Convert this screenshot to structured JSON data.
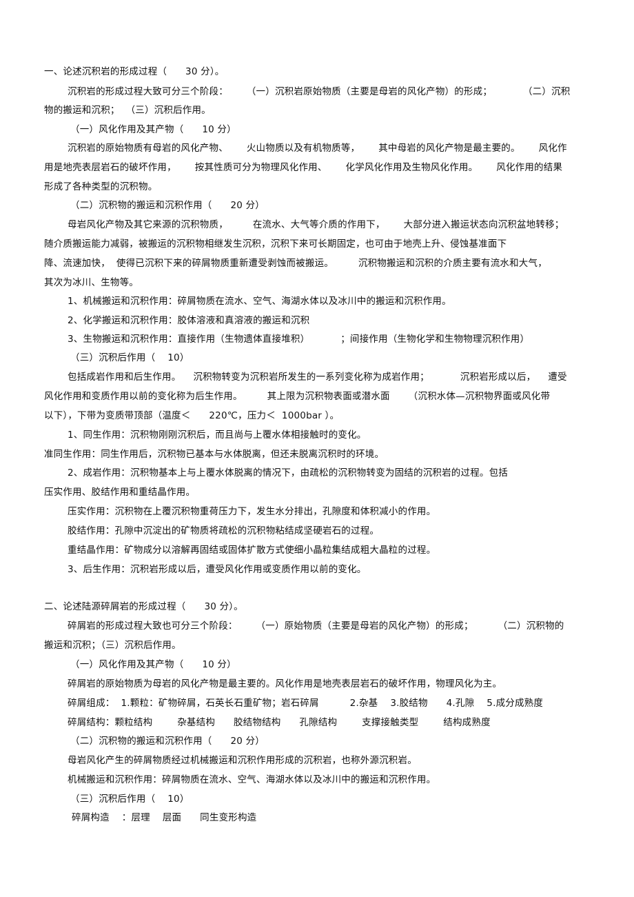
{
  "document": {
    "lines": [
      {
        "id": "q1-title",
        "text": "一、论述沉积岩的形成过程（      30 分）。"
      },
      {
        "id": "q1-intro-1",
        "text": "沉积岩的形成过程大致可分三个阶段：      （一）沉积岩原始物质（主要是母岩的风化产物）的形成；          （二）沉积"
      },
      {
        "id": "q1-intro-2",
        "text": "物的搬运和沉积；  （三）沉积后作用。"
      },
      {
        "id": "q1-s1-heading",
        "text": "（一）风化作用及其产物（      10 分）"
      },
      {
        "id": "q1-s1-p1",
        "text": "沉积岩的原始物质有母岩的风化产物、      火山物质以及有机物质等，      其中母岩的风化产物是最主要的。      风化作"
      },
      {
        "id": "q1-s1-p2",
        "text": "用是地壳表层岩石的破坏作用，      按其性质可分为物理风化作用、      化学风化作用及生物风化作用。      风化作用的结果"
      },
      {
        "id": "q1-s1-p3",
        "text": "形成了各种类型的沉积物。"
      },
      {
        "id": "q1-s2-heading",
        "text": "（二）沉积物的搬运和沉积作用（      20 分）"
      },
      {
        "id": "q1-s2-p1",
        "text": "母岩风化产物及其它来源的沉积物质，        在流水、大气等介质的作用下，      大部分进入搬运状态向沉积盆地转移；"
      },
      {
        "id": "q1-s2-p2",
        "text": "随介质搬运能力减弱，被搬运的沉积物相继发生沉积，沉积下来可长期固定，也可由于地壳上升、侵蚀基准面下"
      },
      {
        "id": "q1-s2-p3",
        "text": "降、流速加快，  使得已沉积下来的碎屑物质重新遭受剥蚀而被搬运。        沉积物搬运和沉积的介质主要有流水和大气，"
      },
      {
        "id": "q1-s2-p4",
        "text": "其次为冰川、生物等。"
      },
      {
        "id": "q1-s2-i1",
        "text": "1、机械搬运和沉积作用：碎屑物质在流水、空气、海湖水体以及冰川中的搬运和沉积作用。"
      },
      {
        "id": "q1-s2-i2",
        "text": "2、化学搬运和沉积作用：胶体溶液和真溶液的搬运和沉积"
      },
      {
        "id": "q1-s2-i3",
        "text": "3、生物搬运和沉积作用：直接作用（生物遗体直接堆积）          ；间接作用（生物化学和生物物理沉积作用）"
      },
      {
        "id": "q1-s3-heading",
        "text": "（三）沉积后作用（    10）"
      },
      {
        "id": "q1-s3-p1",
        "text": "包括成岩作用和后生作用。    沉积物转变为沉积岩所发生的一系列变化称为成岩作用；          沉积岩形成以后，    遭受"
      },
      {
        "id": "q1-s3-p2",
        "text": "风化作用和变质作用以前的变化称为后生作用。        其上限为沉积物表面或潜水面      （沉积水体—沉积物界面或风化带"
      },
      {
        "id": "q1-s3-p3",
        "text": "以下），下带为变质带顶部（温度＜      220℃，压力＜  1000bar ）。"
      },
      {
        "id": "q1-s3-i1",
        "text": "1、同生作用：沉积物刚刚沉积后，而且尚与上覆水体相接触时的变化。"
      },
      {
        "id": "q1-s3-i1b",
        "text": "准同生作用：同生作用后，沉积物已基本与水体脱离，但还未脱离沉积时的环境。"
      },
      {
        "id": "q1-s3-i2",
        "text": "2、成岩作用：沉积物基本上与上覆水体脱离的情况下，由疏松的沉积物转变为固结的沉积岩的过程。包括"
      },
      {
        "id": "q1-s3-i2b",
        "text": "压实作用、胶结作用和重结晶作用。"
      },
      {
        "id": "q1-s3-i2c",
        "text": "压实作用：沉积物在上覆沉积物重荷压力下，发生水分排出，孔隙度和体积减小的作用。"
      },
      {
        "id": "q1-s3-i2d",
        "text": "胶结作用：孔隙中沉淀出的矿物质将疏松的沉积物粘结成坚硬岩石的过程。"
      },
      {
        "id": "q1-s3-i2e",
        "text": "重结晶作用：矿物成分以溶解再固结或固体扩散方式使细小晶粒集结成粗大晶粒的过程。"
      },
      {
        "id": "q1-s3-i3",
        "text": "3、后生作用：沉积岩形成以后，遭受风化作用或变质作用以前的变化。"
      },
      {
        "id": "q2-title",
        "text": "二、论述陆源碎屑岩的形成过程（      30 分）。"
      },
      {
        "id": "q2-intro-1",
        "text": "碎屑岩的形成过程大致也可分三个阶段：      （一）原始物质（主要是母岩的风化产物）的形成；        （二）沉积物的"
      },
      {
        "id": "q2-intro-2",
        "text": "搬运和沉积；（三）沉积后作用。"
      },
      {
        "id": "q2-s1-heading",
        "text": "（一）风化作用及其产物（      10 分）"
      },
      {
        "id": "q2-s1-p1",
        "text": "碎屑岩的原始物质为母岩的风化产物是最主要的。风化作用是地壳表层岩石的破坏作用，物理风化为主。"
      },
      {
        "id": "q2-s1-p2",
        "text": "碎屑组成：  1.颗粒：矿物碎屑，石英长石重矿物；岩石碎屑          2.杂基    3.胶结物      4.孔隙    5.成分成熟度"
      },
      {
        "id": "q2-s1-p3",
        "text": "碎屑结构：颗粒结构        杂基结构      胶结物结构      孔隙结构        支撑接触类型        结构成熟度"
      },
      {
        "id": "q2-s2-heading",
        "text": "（二）沉积物的搬运和沉积作用（      20 分）"
      },
      {
        "id": "q2-s2-p1",
        "text": "母岩风化产生的碎屑物质经过机械搬运和沉积作用形成的沉积岩，也称外源沉积岩。"
      },
      {
        "id": "q2-s2-p2",
        "text": "机械搬运和沉积作用：碎屑物质在流水、空气、海湖水体以及冰川中的搬运和沉积作用。"
      },
      {
        "id": "q2-s3-heading",
        "text": "（三）沉积后作用（    10）"
      },
      {
        "id": "q2-s3-p1",
        "text": "碎屑构造    ：层理    层面      同生变形构造"
      }
    ]
  }
}
